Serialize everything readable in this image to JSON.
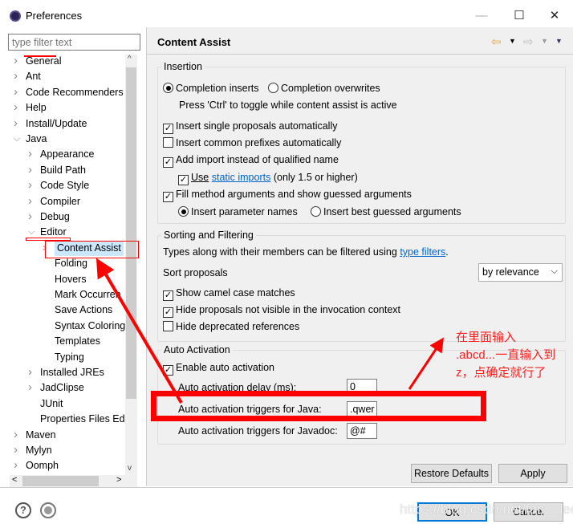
{
  "window": {
    "title": "Preferences",
    "minimize": "—",
    "maximize": "☐",
    "close": "✕"
  },
  "sidebar": {
    "filter_placeholder": "type filter text",
    "items": [
      {
        "label": "General",
        "level": 0,
        "expander": "collapsed"
      },
      {
        "label": "Ant",
        "level": 0,
        "expander": "collapsed"
      },
      {
        "label": "Code Recommenders",
        "level": 0,
        "expander": "collapsed"
      },
      {
        "label": "Help",
        "level": 0,
        "expander": "collapsed"
      },
      {
        "label": "Install/Update",
        "level": 0,
        "expander": "collapsed"
      },
      {
        "label": "Java",
        "level": 0,
        "expander": "expanded"
      },
      {
        "label": "Appearance",
        "level": 1,
        "expander": "collapsed"
      },
      {
        "label": "Build Path",
        "level": 1,
        "expander": "collapsed"
      },
      {
        "label": "Code Style",
        "level": 1,
        "expander": "collapsed"
      },
      {
        "label": "Compiler",
        "level": 1,
        "expander": "collapsed"
      },
      {
        "label": "Debug",
        "level": 1,
        "expander": "collapsed"
      },
      {
        "label": "Editor",
        "level": 1,
        "expander": "expanded"
      },
      {
        "label": "Content Assist",
        "level": 2,
        "expander": "collapsed",
        "selected": true
      },
      {
        "label": "Folding",
        "level": 2,
        "expander": "none"
      },
      {
        "label": "Hovers",
        "level": 2,
        "expander": "none"
      },
      {
        "label": "Mark Occurren",
        "level": 2,
        "expander": "none"
      },
      {
        "label": "Save Actions",
        "level": 2,
        "expander": "none"
      },
      {
        "label": "Syntax Coloring",
        "level": 2,
        "expander": "none"
      },
      {
        "label": "Templates",
        "level": 2,
        "expander": "none"
      },
      {
        "label": "Typing",
        "level": 2,
        "expander": "none"
      },
      {
        "label": "Installed JREs",
        "level": 1,
        "expander": "collapsed"
      },
      {
        "label": "JadClipse",
        "level": 1,
        "expander": "collapsed"
      },
      {
        "label": "JUnit",
        "level": 1,
        "expander": "none"
      },
      {
        "label": "Properties Files Ed",
        "level": 1,
        "expander": "none"
      },
      {
        "label": "Maven",
        "level": 0,
        "expander": "collapsed"
      },
      {
        "label": "Mylyn",
        "level": 0,
        "expander": "collapsed"
      },
      {
        "label": "Oomph",
        "level": 0,
        "expander": "collapsed"
      }
    ]
  },
  "page": {
    "title": "Content Assist",
    "insertion": {
      "label": "Insertion",
      "completion_inserts": "Completion inserts",
      "completion_overwrites": "Completion overwrites",
      "toggle_hint": "Press 'Ctrl' to toggle while content assist is active",
      "single_proposals": "Insert single proposals automatically",
      "common_prefixes": "Insert common prefixes automatically",
      "add_import": "Add import instead of qualified name",
      "use": "Use",
      "static_imports": "static imports",
      "static_suffix": "(only 1.5 or higher)",
      "fill_args": "Fill method arguments and show guessed arguments",
      "param_names": "Insert parameter names",
      "best_guessed": "Insert best guessed arguments"
    },
    "sorting": {
      "label": "Sorting and Filtering",
      "types_text": "Types along with their members can be filtered using",
      "type_filters": "type filters",
      "period": ".",
      "sort_label": "Sort proposals",
      "sort_value": "by relevance",
      "camel": "Show camel case matches",
      "hide_invisible": "Hide proposals not visible in the invocation context",
      "hide_deprecated": "Hide deprecated references"
    },
    "auto": {
      "label": "Auto Activation",
      "enable": "Enable auto activation",
      "delay_label": "Auto activation delay (ms):",
      "delay_value": "0",
      "java_label": "Auto activation triggers for Java:",
      "java_value": ".qwer",
      "javadoc_label": "Auto activation triggers for Javadoc:",
      "javadoc_value": "@#"
    },
    "restore_defaults": "Restore Defaults",
    "apply": "Apply"
  },
  "footer": {
    "ok": "OK",
    "cancel": "Cancel"
  },
  "annotation": {
    "line1": "在里面输入",
    ".line2": "",
    "line2": ".abcd...一直输入到",
    "line3": "z，点确定就行了",
    "color": "#ff0000"
  },
  "watermark": "https://blog.csdn.net/fan__lee"
}
